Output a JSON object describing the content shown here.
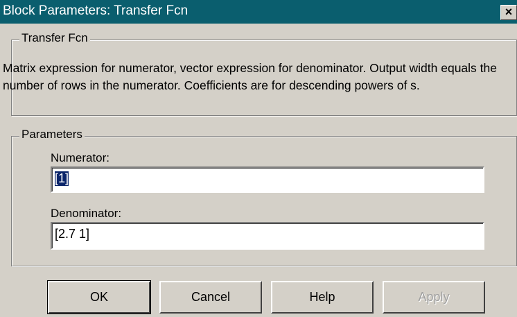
{
  "window": {
    "title": "Block Parameters: Transfer Fcn",
    "close_glyph": "×"
  },
  "description_group": {
    "legend": "Transfer Fcn",
    "text": "Matrix expression for numerator, vector expression for denominator.  Output width equals the number of rows in the numerator.  Coefficients are for descending powers of s."
  },
  "parameters_group": {
    "legend": "Parameters",
    "numerator_label": "Numerator:",
    "numerator_value": "[1]",
    "denominator_label": "Denominator:",
    "denominator_value": "[2.7 1]"
  },
  "buttons": {
    "ok": "OK",
    "cancel": "Cancel",
    "help": "Help",
    "apply": "Apply"
  },
  "colors": {
    "titlebar": "#0a5e6e",
    "face": "#d4d0c8",
    "selection": "#0a246a"
  },
  "icons": {
    "close": "close-icon"
  }
}
